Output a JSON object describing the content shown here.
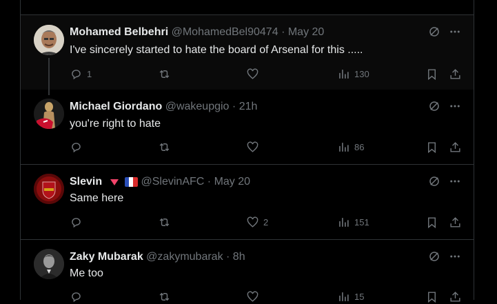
{
  "colors": {
    "bg": "#000000",
    "text": "#e7e9ea",
    "muted": "#71767b",
    "border": "#2f3336"
  },
  "tweets": [
    {
      "name": "Mohamed Belbehri",
      "handle": "@MohamedBel90474",
      "sep": "·",
      "time": "May 20",
      "text": "I've sincerely started to hate the board of Arsenal for this .....",
      "replies": "1",
      "retweets": "",
      "likes": "",
      "views": "130"
    },
    {
      "name": "Michael Giordano",
      "handle": "@wakeupgio",
      "sep": "·",
      "time": "21h",
      "text": "you're right to hate",
      "replies": "",
      "retweets": "",
      "likes": "",
      "views": "86"
    },
    {
      "name": "Slevin",
      "handle": "@SlevinAFC",
      "sep": "·",
      "time": "May 20",
      "text": "Same here",
      "replies": "",
      "retweets": "",
      "likes": "2",
      "views": "151"
    },
    {
      "name": "Zaky Mubarak",
      "handle": "@zakymubarak",
      "sep": "·",
      "time": "8h",
      "text": "Me too",
      "replies": "",
      "retweets": "",
      "likes": "",
      "views": "15"
    }
  ]
}
